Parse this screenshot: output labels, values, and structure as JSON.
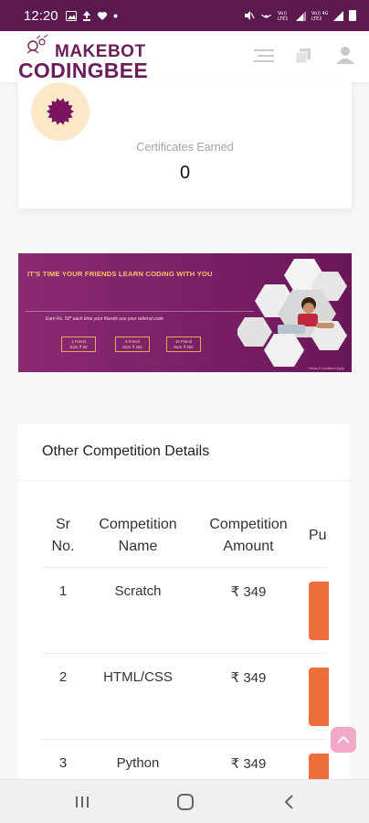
{
  "status_bar": {
    "time": "12:20",
    "left_icons": [
      "image-icon",
      "upload-icon",
      "heart-icon",
      "dot-icon"
    ],
    "right_icons": [
      "mute-icon",
      "hotspot-icon",
      "volte-icon",
      "signal-icon",
      "volte-lte-icon",
      "signal-icon",
      "battery-icon"
    ],
    "volte1": "Vo))\nLTE1",
    "volte2": "Vo))  4G\nLTE2"
  },
  "header": {
    "logo_line1": "MAKEBOT",
    "logo_line2": "CODINGBEE",
    "icons": [
      "menu-icon",
      "copy-icon",
      "user-icon"
    ]
  },
  "certificates": {
    "label": "Certificates Earned",
    "value": "0",
    "badge_color": "#7a1460"
  },
  "banner": {
    "headline": "IT'S TIME YOUR FRIENDS LEARN CODING WITH YOU",
    "subline": "Earn Rs. 50* each time your friends use your referral code",
    "friends": [
      {
        "label": "1 Friend",
        "earn": "Earn ₹ 50"
      },
      {
        "label": "5 Friend",
        "earn": "Earn ₹ 250"
      },
      {
        "label": "10 Friend",
        "earn": "Earn ₹ 500"
      }
    ],
    "fine_print": "*Terms & Conditions Apply"
  },
  "competition": {
    "title": "Other Competition Details",
    "columns": [
      {
        "label": "Sr\nNo."
      },
      {
        "label": "Competition\nName"
      },
      {
        "label": "Competition\nAmount"
      },
      {
        "label": "Pu"
      }
    ],
    "rows": [
      {
        "sr": "1",
        "name": "Scratch",
        "amount": "₹ 349"
      },
      {
        "sr": "2",
        "name": "HTML/CSS",
        "amount": "₹ 349"
      },
      {
        "sr": "3",
        "name": "Python",
        "amount": "₹ 349"
      }
    ],
    "button_color": "#ee6f3c"
  },
  "nav": {
    "icons": [
      "recent-apps-icon",
      "home-icon",
      "back-icon"
    ]
  },
  "colors": {
    "brand": "#6b1f5a",
    "status_bar": "#5b1950",
    "accent": "#ee6f3c",
    "scroll_top": "#f2a9c6"
  }
}
